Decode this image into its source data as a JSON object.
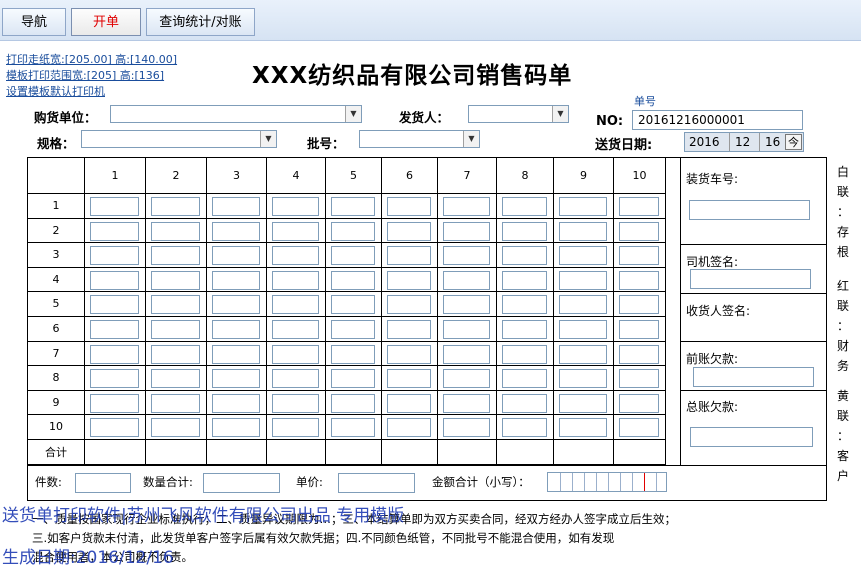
{
  "tabs": [
    {
      "label": "导航"
    },
    {
      "label": "开单"
    },
    {
      "label": "查询统计/对账"
    }
  ],
  "links": {
    "print_paper": "打印走纸宽:[205.00] 高:[140.00]",
    "template_range": "模板打印范围宽:[205] 高:[136]",
    "default_printer": "设置模板默认打印机"
  },
  "title": "XXX纺织品有限公司销售码单",
  "form": {
    "buyer_label": "购货单位：",
    "shipper_label": "发货人：",
    "spec_label": "规格：",
    "batch_label": "批号：",
    "order_no_caption": "单号",
    "no_label": "NO:",
    "order_no": "20161216000001",
    "delivery_date_label": "送货日期:",
    "date_year": "2016",
    "date_month": "12",
    "date_day": "16",
    "today_button": "今"
  },
  "grid": {
    "columns": [
      "1",
      "2",
      "3",
      "4",
      "5",
      "6",
      "7",
      "8",
      "9",
      "10"
    ],
    "rows": [
      "1",
      "2",
      "3",
      "4",
      "5",
      "6",
      "7",
      "8",
      "9",
      "10"
    ],
    "total_label": "合计"
  },
  "side": {
    "truck_no": "装货车号:",
    "driver_sign": "司机签名:",
    "receiver_sign": "收货人签名:",
    "previous_debt": "前账欠款:",
    "total_debt": "总账欠款:"
  },
  "copies": {
    "white": "白联：存根",
    "red": "红联：财务",
    "yellow": "黄联：客户"
  },
  "summary": {
    "pieces_label": "件数:",
    "qty_total_label": "数量合计:",
    "unit_price_label": "单价:",
    "amount_label": "金额合计（小写）："
  },
  "terms": {
    "line1": "一、质量按国家现行企业标准执行；二、质量异议期限为…；三、本结算单即为双方买卖合同，经双方经办人签字成立后生效；",
    "line2": "三.如客户货款未付清，此发货单客户签字后属有效欠款凭据；四.不同颜色纸管，不同批号不能混合使用，如有发现",
    "line3": "混合使用者，本公司概不负责。"
  },
  "watermark": {
    "line1": "送货单打印软件|苏州飞风软件有限公司出品 专用模版",
    "line2": "生成日期:2016/12/16"
  },
  "colors": {
    "accent_tab": "#e00000",
    "watermark": "#1f3bb3",
    "link": "#1a4d9c"
  }
}
